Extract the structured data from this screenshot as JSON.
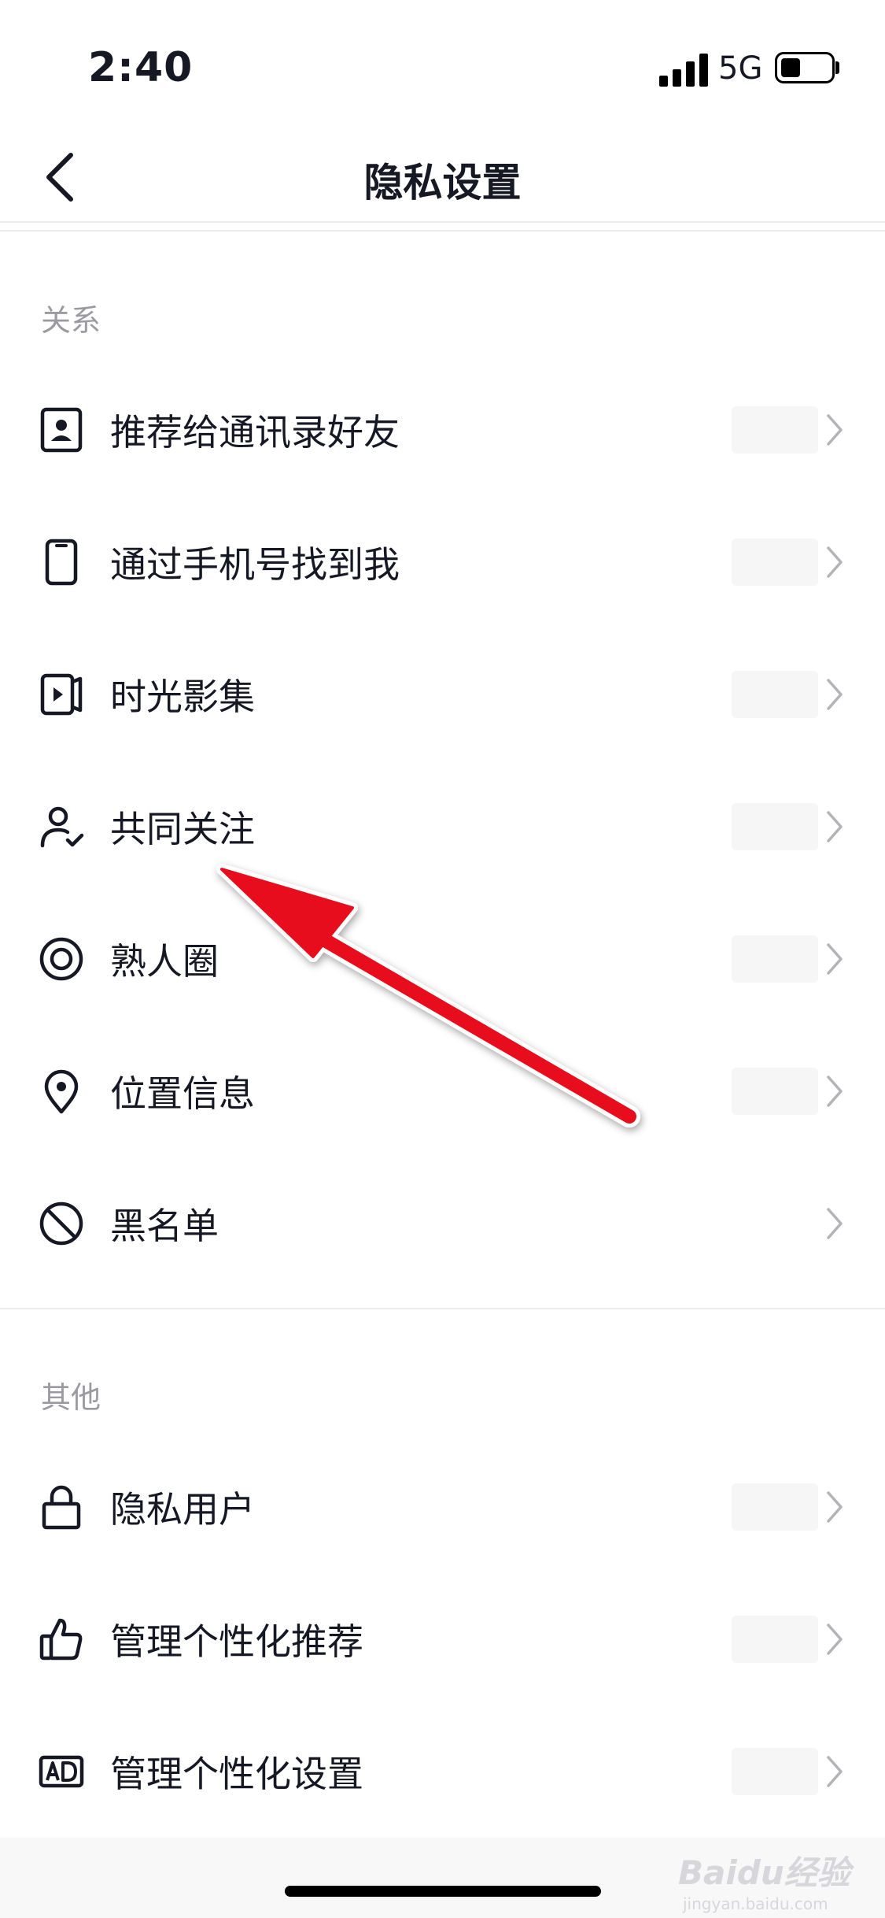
{
  "status_bar": {
    "time": "2:40",
    "network": "5G"
  },
  "header": {
    "title": "隐私设置"
  },
  "sections": [
    {
      "title": "关系",
      "items": [
        {
          "label": "推荐给通讯录好友",
          "icon": "contact-card-icon"
        },
        {
          "label": "通过手机号找到我",
          "icon": "phone-icon"
        },
        {
          "label": "时光影集",
          "icon": "photo-album-icon"
        },
        {
          "label": "共同关注",
          "icon": "user-check-icon"
        },
        {
          "label": "熟人圈",
          "icon": "circle-target-icon"
        },
        {
          "label": "位置信息",
          "icon": "location-pin-icon"
        },
        {
          "label": "黑名单",
          "icon": "block-icon"
        }
      ]
    },
    {
      "title": "其他",
      "items": [
        {
          "label": "隐私用户",
          "icon": "lock-icon"
        },
        {
          "label": "管理个性化推荐",
          "icon": "thumbs-up-icon"
        },
        {
          "label": "管理个性化设置",
          "icon": "ad-icon"
        }
      ]
    }
  ],
  "watermark": {
    "main": "Baidu经验",
    "sub": "jingyan.baidu.com"
  },
  "colors": {
    "annotation_arrow": "#e8111b",
    "text": "#161823",
    "section_title": "#9a9aa0"
  }
}
